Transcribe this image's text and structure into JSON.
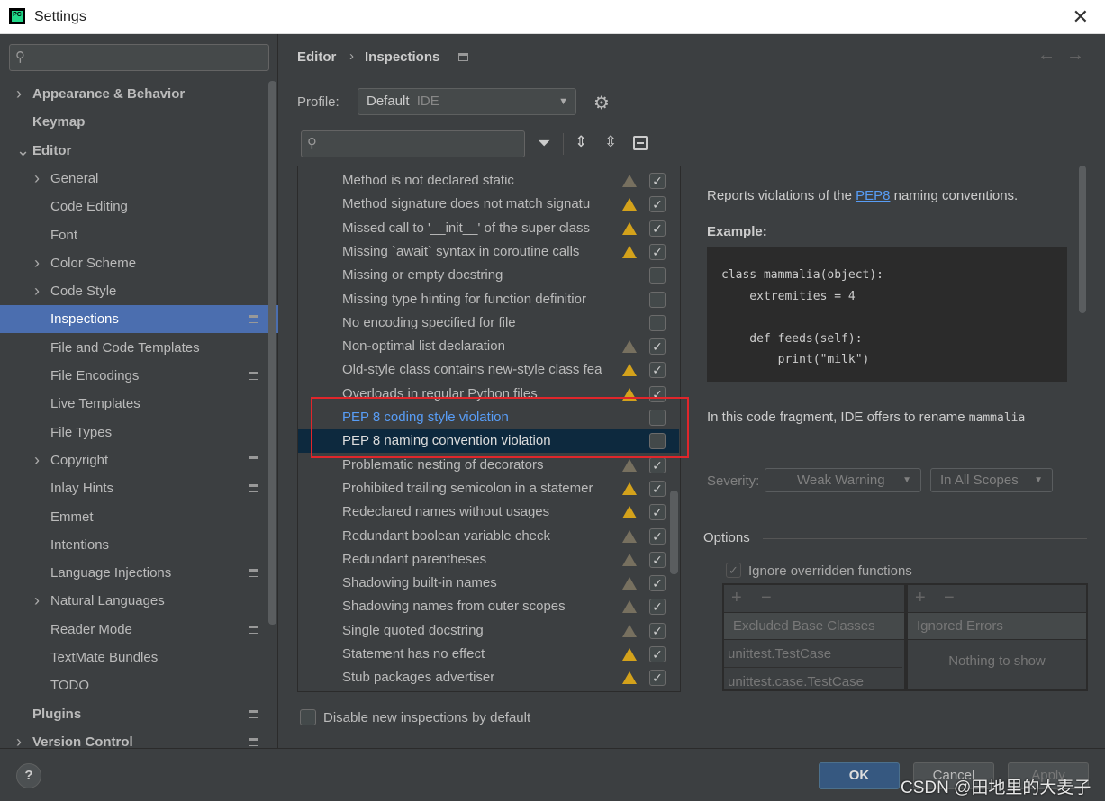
{
  "window": {
    "title": "Settings",
    "close_icon": "close-icon"
  },
  "sidebar": {
    "search_placeholder": "",
    "items": [
      {
        "label": "Appearance & Behavior",
        "level": 0,
        "expandable": true,
        "bold": true
      },
      {
        "label": "Keymap",
        "level": 0,
        "bold": true
      },
      {
        "label": "Editor",
        "level": 0,
        "expanded": true,
        "bold": true
      },
      {
        "label": "General",
        "level": 1,
        "expandable": true
      },
      {
        "label": "Code Editing",
        "level": 1
      },
      {
        "label": "Font",
        "level": 1
      },
      {
        "label": "Color Scheme",
        "level": 1,
        "expandable": true
      },
      {
        "label": "Code Style",
        "level": 1,
        "expandable": true
      },
      {
        "label": "Inspections",
        "level": 1,
        "selected": true,
        "project": true
      },
      {
        "label": "File and Code Templates",
        "level": 1
      },
      {
        "label": "File Encodings",
        "level": 1,
        "project": true
      },
      {
        "label": "Live Templates",
        "level": 1
      },
      {
        "label": "File Types",
        "level": 1
      },
      {
        "label": "Copyright",
        "level": 1,
        "expandable": true,
        "project": true
      },
      {
        "label": "Inlay Hints",
        "level": 1,
        "project": true
      },
      {
        "label": "Emmet",
        "level": 1
      },
      {
        "label": "Intentions",
        "level": 1
      },
      {
        "label": "Language Injections",
        "level": 1,
        "project": true
      },
      {
        "label": "Natural Languages",
        "level": 1,
        "expandable": true
      },
      {
        "label": "Reader Mode",
        "level": 1,
        "project": true
      },
      {
        "label": "TextMate Bundles",
        "level": 1
      },
      {
        "label": "TODO",
        "level": 1
      },
      {
        "label": "Plugins",
        "level": 0,
        "bold": true,
        "project": true
      },
      {
        "label": "Version Control",
        "level": 0,
        "expandable": true,
        "bold": true,
        "project": true
      }
    ]
  },
  "breadcrumb": {
    "parent": "Editor",
    "current": "Inspections"
  },
  "profile": {
    "label": "Profile:",
    "value": "Default",
    "scope": "IDE"
  },
  "inspections": [
    {
      "label": "Method is not declared static",
      "severity": "weak",
      "checked": true
    },
    {
      "label": "Method signature does not match signatu",
      "severity": "warning",
      "checked": true
    },
    {
      "label": "Missed call to '__init__' of the super class",
      "severity": "warning",
      "checked": true
    },
    {
      "label": "Missing `await` syntax in coroutine calls",
      "severity": "warning",
      "checked": true
    },
    {
      "label": "Missing or empty docstring",
      "severity": "none",
      "checked": false
    },
    {
      "label": "Missing type hinting for function definitior",
      "severity": "none",
      "checked": false
    },
    {
      "label": "No encoding specified for file",
      "severity": "none",
      "checked": false
    },
    {
      "label": "Non-optimal list declaration",
      "severity": "weak",
      "checked": true
    },
    {
      "label": "Old-style class contains new-style class fea",
      "severity": "warning",
      "checked": true
    },
    {
      "label": "Overloads in regular Python files",
      "severity": "warning",
      "checked": true
    },
    {
      "label": "PEP 8 coding style violation",
      "severity": "none",
      "checked": false,
      "modified": true
    },
    {
      "label": "PEP 8 naming convention violation",
      "severity": "none",
      "checked": false,
      "selected": true
    },
    {
      "label": "Problematic nesting of decorators",
      "severity": "weak",
      "checked": true
    },
    {
      "label": "Prohibited trailing semicolon in a statemer",
      "severity": "warning",
      "checked": true
    },
    {
      "label": "Redeclared names without usages",
      "severity": "warning",
      "checked": true
    },
    {
      "label": "Redundant boolean variable check",
      "severity": "weak",
      "checked": true
    },
    {
      "label": "Redundant parentheses",
      "severity": "weak",
      "checked": true
    },
    {
      "label": "Shadowing built-in names",
      "severity": "weak",
      "checked": true
    },
    {
      "label": "Shadowing names from outer scopes",
      "severity": "weak",
      "checked": true
    },
    {
      "label": "Single quoted docstring",
      "severity": "weak",
      "checked": true
    },
    {
      "label": "Statement has no effect",
      "severity": "warning",
      "checked": true
    },
    {
      "label": "Stub packages advertiser",
      "severity": "warning",
      "checked": true
    }
  ],
  "description": {
    "pre": "Reports violations of the ",
    "link": "PEP8",
    "post": " naming conventions.",
    "example_label": "Example:",
    "code": "class mammalia(object):\n    extremities = 4\n\n    def feeds(self):\n        print(\"milk\")",
    "note": "In this code fragment, IDE offers to rename ",
    "note_code": "mammalia"
  },
  "severity": {
    "label": "Severity:",
    "value": "Weak Warning",
    "scope": "In All Scopes"
  },
  "options": {
    "title": "Options",
    "ignore_overridden": "Ignore overridden functions",
    "ignore_checked": true,
    "excluded_header": "Excluded Base Classes",
    "excluded": [
      "unittest.TestCase",
      "unittest.case.TestCase"
    ],
    "ignored_header": "Ignored Errors",
    "ignored_empty": "Nothing to show",
    "add": "+",
    "remove": "−"
  },
  "disable_new": "Disable new inspections by default",
  "buttons": {
    "ok": "OK",
    "cancel": "Cancel",
    "apply": "Apply",
    "help": "?"
  },
  "watermark": "CSDN @田地里的大麦子",
  "colors": {
    "selection": "#4b6eaf",
    "row_selected": "#0d293e",
    "warning": "#d4a21b",
    "weak_warning": "#77705f",
    "link": "#589df6",
    "highlight_box": "#e0262b"
  }
}
